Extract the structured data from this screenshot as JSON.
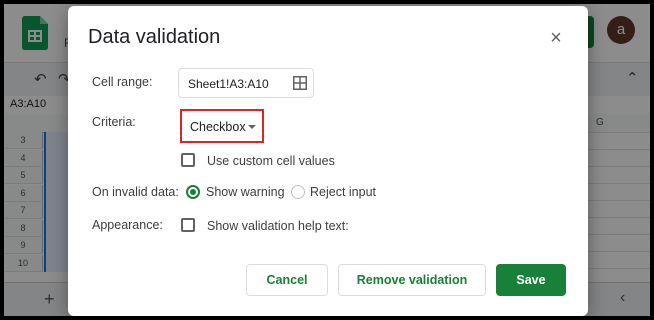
{
  "background": {
    "doc_letter": "F",
    "avatar_initial": "a",
    "name_box": "A3:A10",
    "column_g": "G",
    "row_numbers": [
      "3",
      "4",
      "5",
      "6",
      "7",
      "8",
      "9",
      "10"
    ],
    "add_sheet": "+",
    "nav_left": "‹"
  },
  "dialog": {
    "title": "Data validation",
    "close": "×",
    "cell_range_label": "Cell range:",
    "cell_range_value": "Sheet1!A3:A10",
    "criteria_label": "Criteria:",
    "criteria_value": "Checkbox",
    "custom_values_label": "Use custom cell values",
    "invalid_label": "On invalid data:",
    "show_warning": "Show warning",
    "reject_input": "Reject input",
    "appearance_label": "Appearance:",
    "help_text_label": "Show validation help text:",
    "cancel": "Cancel",
    "remove": "Remove validation",
    "save": "Save"
  },
  "colors": {
    "accent_green": "#188038",
    "highlight_red": "#d9252b"
  }
}
